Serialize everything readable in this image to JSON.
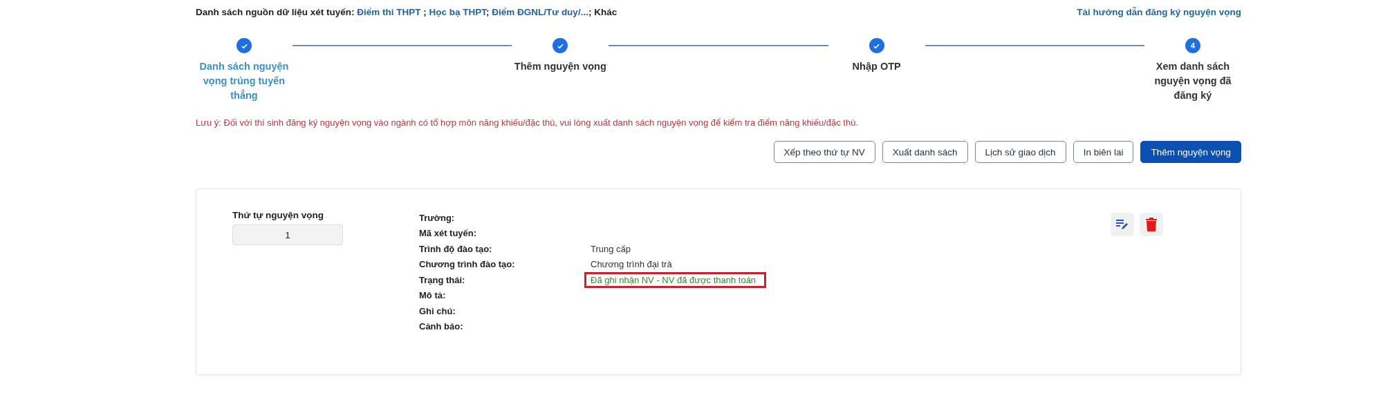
{
  "header": {
    "label": "Danh sách nguồn dữ liệu xét tuyến:",
    "parts": [
      {
        "text": "Điểm thi THPT",
        "link": true
      },
      {
        "text": " ; ",
        "link": false
      },
      {
        "text": "Học bạ THPT",
        "link": true
      },
      {
        "text": "; ",
        "link": false
      },
      {
        "text": "Điểm ĐGNL/Tư duy/...",
        "link": true
      },
      {
        "text": "; Khác",
        "link": false
      }
    ],
    "guide_link": "Tải hướng dẫn đăng ký nguyện vọng"
  },
  "steps": [
    {
      "label": "Danh sách nguyện vọng trúng tuyển thẳng",
      "done": true,
      "link": true
    },
    {
      "label": "Thêm nguyện vọng",
      "done": true,
      "link": false
    },
    {
      "label": "Nhập OTP",
      "done": true,
      "link": false
    },
    {
      "label": "Xem danh sách nguyện vọng đã đăng ký",
      "done": false,
      "link": false,
      "number": "4"
    }
  ],
  "note": "Lưu ý: Đối với thí sinh đăng ký nguyện vọng vào ngành có tổ hợp môn năng khiếu/đặc thù, vui lòng xuất danh sách nguyện vọng để kiểm tra điểm năng khiếu/đặc thù.",
  "buttons": [
    {
      "label": "Xếp theo thứ tự NV",
      "primary": false
    },
    {
      "label": "Xuất danh sách",
      "primary": false
    },
    {
      "label": "Lịch sử giao dịch",
      "primary": false
    },
    {
      "label": "In biên lai",
      "primary": false
    },
    {
      "label": "Thêm nguyện vọng",
      "primary": true
    }
  ],
  "card": {
    "order_label": "Thứ tự nguyện vọng",
    "order_value": "1",
    "rows": [
      {
        "label": "Trường:"
      },
      {
        "label": "Mã xét tuyến:"
      },
      {
        "label": "Trình độ đào tạo:",
        "value": "Trung cấp",
        "kind": "plain",
        "highlighted": false
      },
      {
        "label": "Chương trình đào tạo:",
        "value": "Chương trình đại trà",
        "kind": "plain",
        "highlighted": false
      },
      {
        "label": "Trạng thái:",
        "value": "Đã ghi nhận NV - NV đã được thanh toán",
        "kind": "status",
        "highlighted": true
      },
      {
        "label": "Mô tả:"
      },
      {
        "label": "Ghi chú:"
      },
      {
        "label": "Cảnh báo:"
      }
    ]
  }
}
